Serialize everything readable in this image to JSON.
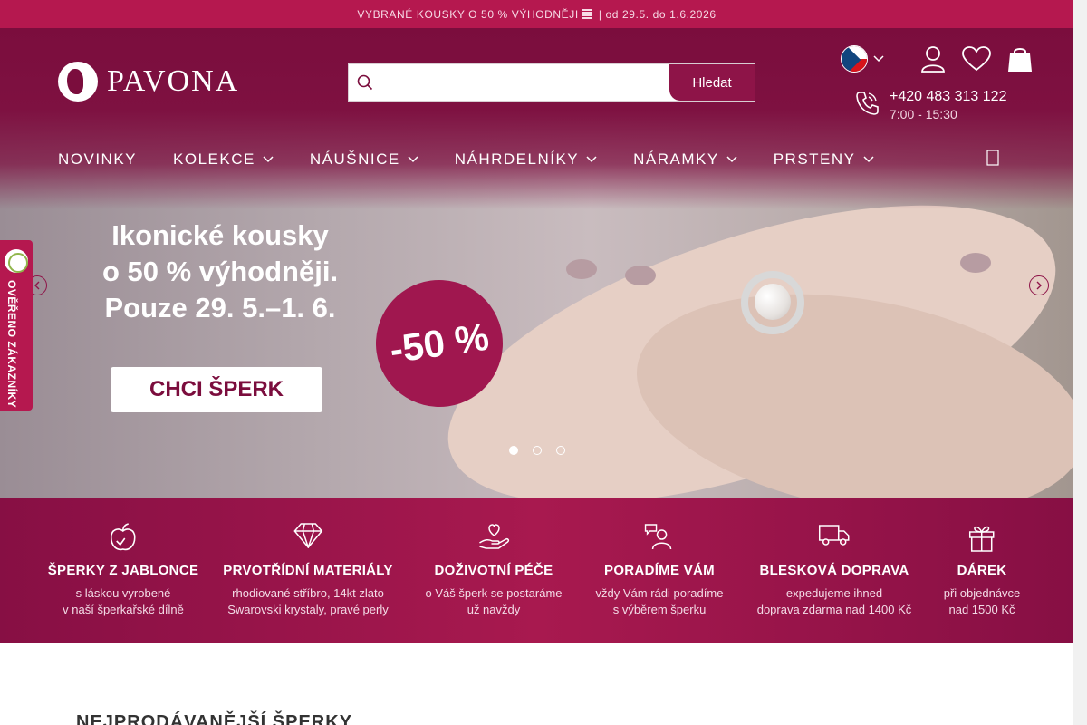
{
  "promo": {
    "text": "VYBRANÉ KOUSKY O 50 % VÝHODNĚJI",
    "date_text": "od 29.5. do 1.6.2026"
  },
  "header": {
    "logo_text": "PAVONA",
    "search": {
      "placeholder": "",
      "button_label": "Hledat"
    },
    "phone": {
      "number": "+420 483 313 122",
      "hours": "7:00 - 15:30"
    }
  },
  "nav": {
    "items": [
      {
        "label": "NOVINKY"
      },
      {
        "label": "KOLEKCE"
      },
      {
        "label": "NÁUŠNICE"
      },
      {
        "label": "NÁHRDELNÍKY"
      },
      {
        "label": "NÁRAMKY"
      },
      {
        "label": "PRSTENY"
      }
    ]
  },
  "hero": {
    "lines": [
      "Ikonické kousky",
      "o 50 % výhodněji.",
      "Pouze 29. 5.–1. 6."
    ],
    "cta_label": "CHCI ŠPERK",
    "badge": "-50 %",
    "slides_total": 3,
    "active_slide": 1
  },
  "verified_badge": {
    "label": "OVĚŘENO ZÁKAZNÍKY"
  },
  "benefits": [
    {
      "icon": "apple-icon",
      "title": "ŠPERKY Z JABLONCE",
      "line1": "s láskou vyrobené",
      "line2": "v naší šperkařské dílně"
    },
    {
      "icon": "diamond-icon",
      "title": "PRVOTŘÍDNÍ MATERIÁLY",
      "line1": "rhodiované stříbro, 14kt zlato",
      "line2": "Swarovski krystaly, pravé perly"
    },
    {
      "icon": "hand-heart-icon",
      "title": "DOŽIVOTNÍ PÉČE",
      "line1": "o Váš šperk se postaráme",
      "line2": "už navždy"
    },
    {
      "icon": "advisor-icon",
      "title": "PORADÍME VÁM",
      "line1": "vždy Vám rádi poradíme",
      "line2": "s výběrem šperku"
    },
    {
      "icon": "truck-icon",
      "title": "BLESKOVÁ DOPRAVA",
      "line1": "expedujeme ihned",
      "line2": "doprava zdarma nad 1400 Kč"
    },
    {
      "icon": "gift-icon",
      "title": "DÁREK",
      "line1": "při objednávce",
      "line2": "nad 1500 Kč"
    }
  ],
  "section": {
    "title": "NEJPRODÁVANĚJŠÍ ŠPERKY"
  },
  "colors": {
    "brand": "#7b0d3d",
    "accent": "#b5184f",
    "button": "#8e1448"
  }
}
